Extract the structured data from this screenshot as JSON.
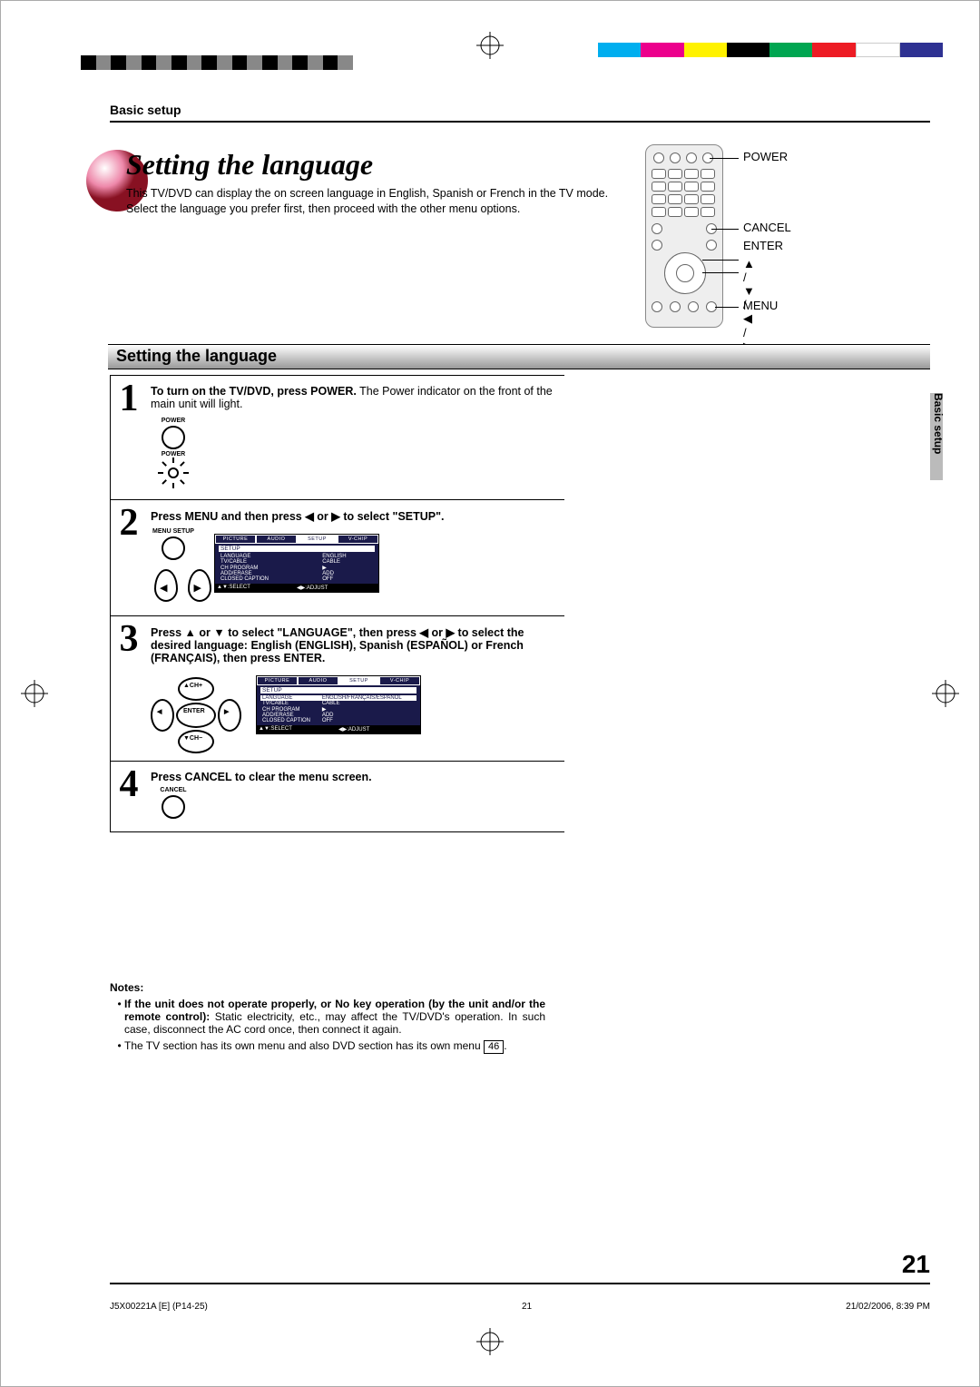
{
  "colors": {
    "c1": "#00aeef",
    "c2": "#ec008c",
    "c3": "#fff200",
    "c4": "#000000",
    "c5": "#00a651",
    "c6": "#ed1c24",
    "c7": "#ffffff",
    "c8": "#2e3192"
  },
  "header": {
    "section": "Basic setup"
  },
  "title": "Setting the language",
  "intro_p1": "This TV/DVD can display the on screen language in English, Spanish or French in the TV mode.",
  "intro_p2": "Select the language you prefer first, then proceed with the other menu options.",
  "remote_labels": {
    "power": "POWER",
    "cancel": "CANCEL",
    "enter": "ENTER",
    "arrows": "▲ / ▼ / ◀ / ▶",
    "menu": "MENU"
  },
  "section_bar": "Setting the language",
  "side_tab": "Basic setup",
  "steps": {
    "s1": {
      "bold": "To turn on the TV/DVD, press POWER.",
      "text": "The Power indicator on the front of the main unit will light.",
      "btn": "POWER",
      "btn2": "POWER"
    },
    "s2": {
      "bold": "Press MENU and then press ◀ or ▶ to select \"SETUP\".",
      "btn": "MENU SETUP"
    },
    "s3": {
      "bold": "Press ▲ or ▼ to select \"LANGUAGE\", then press ◀ or ▶ to select the desired language: English (ENGLISH), Spanish (ESPAÑOL) or French (FRANÇAIS), then press ENTER."
    },
    "s4": {
      "bold": "Press CANCEL to clear the menu screen.",
      "btn": "CANCEL"
    }
  },
  "osd": {
    "tabs": [
      "PICTURE",
      "AUDIO",
      "SETUP",
      "V-CHIP"
    ],
    "setup": "SETUP",
    "rows": [
      {
        "k": "LANGUAGE",
        "v": "ENGLISH"
      },
      {
        "k": "TV/CABLE",
        "v": "CABLE"
      },
      {
        "k": "CH PROGRAM",
        "v": "▶"
      },
      {
        "k": "ADD/ERASE",
        "v": "ADD"
      },
      {
        "k": "CLOSED CAPTION",
        "v": "OFF"
      }
    ],
    "lang_opts": "ENGLISH/FRANÇAIS/ESPAÑOL",
    "ft1": "▲▼:SELECT",
    "ft2": "◀▶:ADJUST"
  },
  "dpad": {
    "up": "▲CH+",
    "down": "▼CH−",
    "enter": "ENTER"
  },
  "notes_hdr": "Notes:",
  "note1b": "If the unit does not operate properly, or No key operation (by the unit and/or the remote control):",
  "note1": " Static electricity, etc., may affect the TV/DVD's operation. In such case, disconnect the AC cord once, then connect it again.",
  "note2a": "The TV section has its own menu and also DVD section has its own menu ",
  "note2b": "46",
  "note2c": ".",
  "page_num": "21",
  "footer": {
    "l": "J5X00221A [E] (P14-25)",
    "c": "21",
    "r": "21/02/2006, 8:39 PM"
  }
}
